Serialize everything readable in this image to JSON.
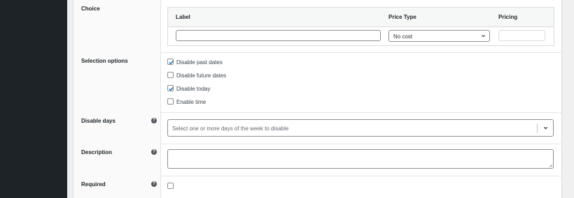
{
  "choice": {
    "label": "Choice",
    "columns": {
      "label": "Label",
      "price_type": "Price Type",
      "pricing": "Pricing"
    },
    "row": {
      "label_value": "",
      "price_type_value": "No cost",
      "pricing_value": ""
    }
  },
  "selection_options": {
    "label": "Selection options",
    "options": [
      {
        "label": "Disable past dates",
        "checked": true
      },
      {
        "label": "Disable future dates",
        "checked": false
      },
      {
        "label": "Disable today",
        "checked": true
      },
      {
        "label": "Enable time",
        "checked": false
      }
    ]
  },
  "disable_days": {
    "label": "Disable days",
    "placeholder": "Select one or more days of the week to disable"
  },
  "description": {
    "label": "Description",
    "value": ""
  },
  "required": {
    "label": "Required",
    "checked": false
  },
  "icons": {
    "help": "help-circle-icon",
    "dropdown": "chevron-down-icon",
    "check": "checkmark-icon"
  },
  "colors": {
    "sidebar": "#1d2327",
    "checkbox_accent": "#2271b1",
    "background": "#f0f0f1"
  }
}
